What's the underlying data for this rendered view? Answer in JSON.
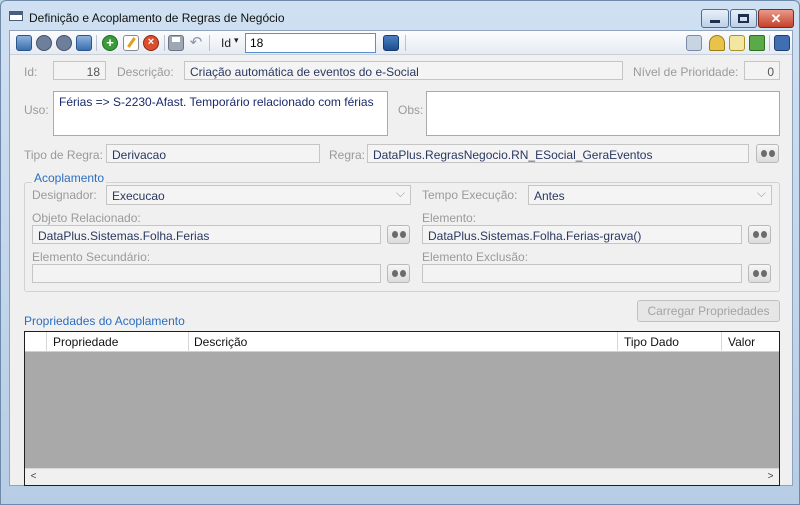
{
  "window": {
    "title": "Definição e Acoplamento de Regras de Negócio",
    "close_glyph": "✕"
  },
  "toolbar": {
    "id_label": "Id",
    "id_dropdown_arrow": "▾",
    "id_value": "18",
    "icons": [
      "first-record-icon",
      "previous-record-icon",
      "next-record-icon",
      "last-record-icon",
      "add-icon",
      "edit-icon",
      "delete-icon",
      "save-icon",
      "undo-icon",
      "search-go-icon",
      "list-icon",
      "key-icon",
      "document-icon",
      "upload-icon",
      "window-icon"
    ]
  },
  "form": {
    "id_label": "Id:",
    "id_value": "18",
    "descricao_label": "Descrição:",
    "descricao_value": "Criação automática de eventos do e-Social",
    "prioridade_label": "Nível de Prioridade:",
    "prioridade_value": "0",
    "uso_label": "Uso:",
    "uso_value": "Férias => S-2230-Afast. Temporário relacionado com férias",
    "obs_label": "Obs:",
    "obs_value": "",
    "tipo_regra_label": "Tipo de Regra:",
    "tipo_regra_value": "Derivacao",
    "regra_label": "Regra:",
    "regra_value": "DataPlus.RegrasNegocio.RN_ESocial_GeraEventos"
  },
  "acoplamento": {
    "title": "Acoplamento",
    "designador_label": "Designador:",
    "designador_value": "Execucao",
    "tempo_label": "Tempo Execução:",
    "tempo_value": "Antes",
    "objeto_label": "Objeto Relacionado:",
    "objeto_value": "DataPlus.Sistemas.Folha.Ferias",
    "elemento_label": "Elemento:",
    "elemento_value": "DataPlus.Sistemas.Folha.Ferias-grava()",
    "secundario_label": "Elemento Secundário:",
    "secundario_value": "",
    "exclusao_label": "Elemento Exclusão:",
    "exclusao_value": ""
  },
  "propriedades": {
    "title": "Propriedades do Acoplamento",
    "load_button": "Carregar Propriedades",
    "columns": [
      "Propriedade",
      "Descrição",
      "Tipo Dado",
      "Valor"
    ],
    "rows": [],
    "scroll_left": "<",
    "scroll_right": ">"
  }
}
